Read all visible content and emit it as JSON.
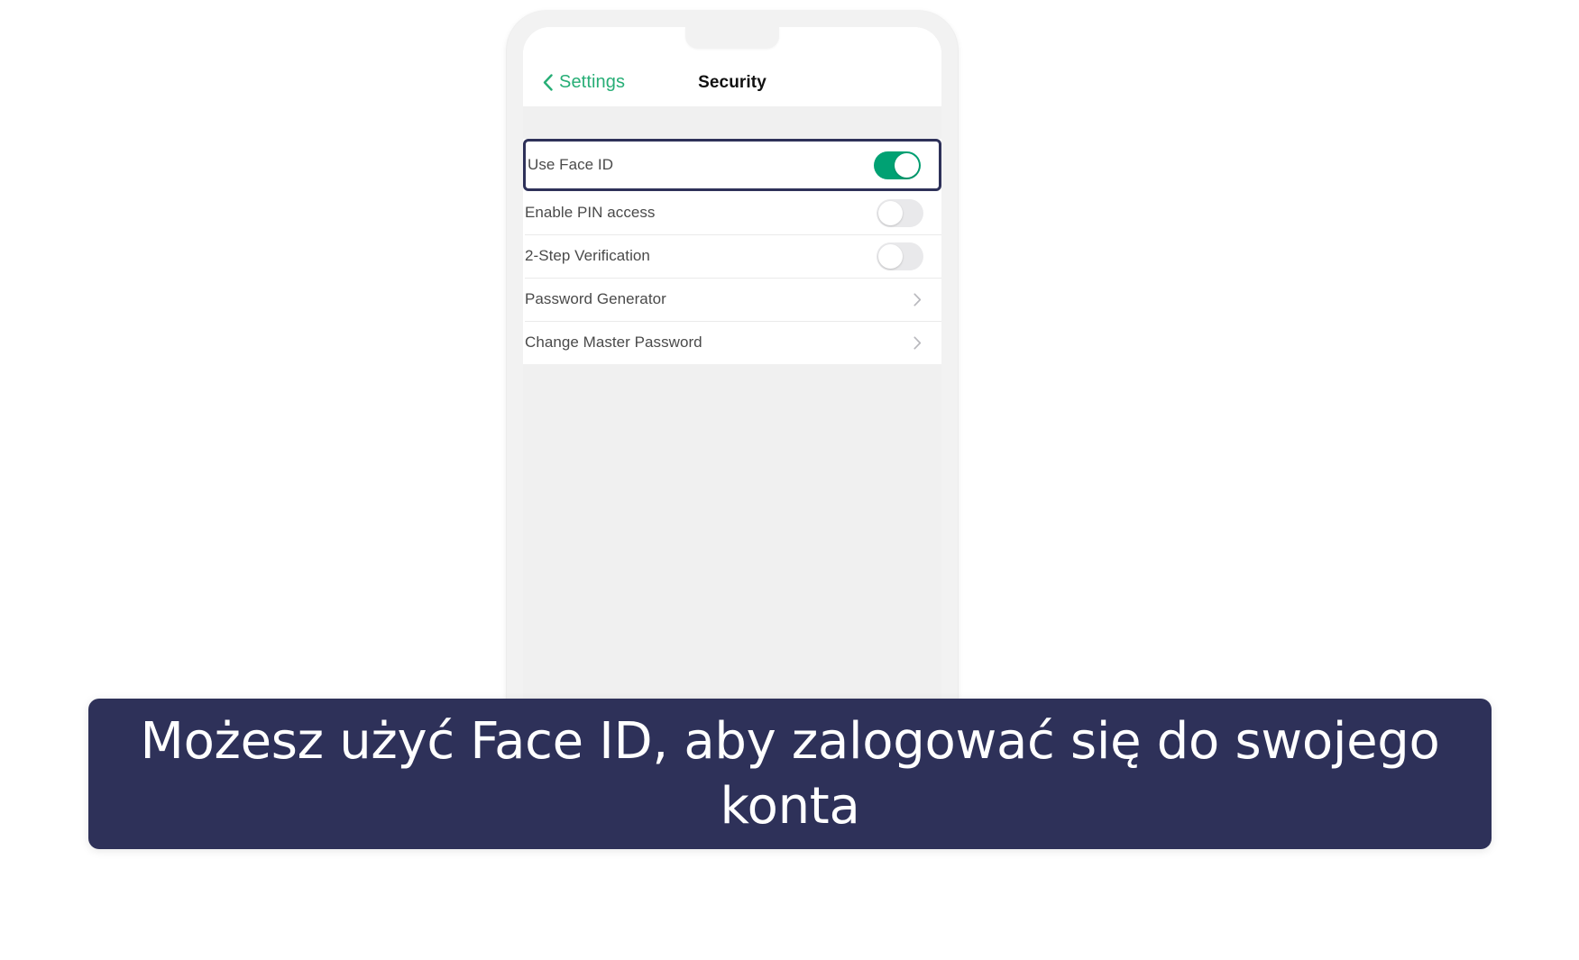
{
  "device": {
    "name": "smartphone-mockup",
    "notch": "notch"
  },
  "nav": {
    "back_label": "Settings",
    "back_icon": "chevron-left-icon",
    "title": "Security"
  },
  "settings": {
    "rows": [
      {
        "label": "Use Face ID",
        "control": "toggle",
        "state": "on",
        "highlighted": true
      },
      {
        "label": "Enable PIN access",
        "control": "toggle",
        "state": "off",
        "highlighted": false
      },
      {
        "label": "2-Step Verification",
        "control": "toggle",
        "state": "off",
        "highlighted": false
      },
      {
        "label": "Password Generator",
        "control": "chevron",
        "state": "",
        "highlighted": false
      },
      {
        "label": "Change Master Password",
        "control": "chevron",
        "state": "",
        "highlighted": false
      }
    ]
  },
  "caption": {
    "text": "Możesz użyć Face ID, aby zalogować się do swojego konta"
  },
  "colors": {
    "accent_green": "#00a173",
    "link_green": "#27ae76",
    "highlight_navy": "#2e3159",
    "banner_navy": "#2e3159",
    "toggle_off": "#e9e9eb",
    "page_background": "#f0f0f0"
  }
}
